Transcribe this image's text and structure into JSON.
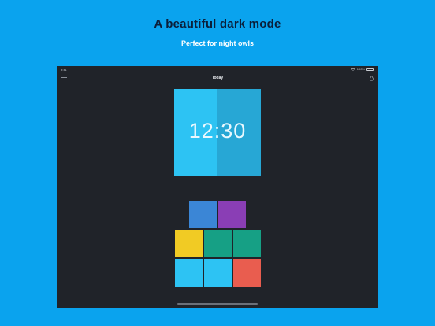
{
  "header": {
    "title": "A beautiful dark mode",
    "subtitle": "Perfect for night owls"
  },
  "status_bar": {
    "time": "9:41",
    "battery_label": "100%",
    "icons": [
      "wifi-icon",
      "battery-icon"
    ]
  },
  "nav": {
    "title": "Today",
    "left_icon": "menu-icon",
    "right_icon": "drop-icon"
  },
  "clock": {
    "time": "12:30",
    "color_left": "#2dc3f3",
    "color_right": "#27a7d5"
  },
  "palette": {
    "rows": [
      [
        "#3b86d6",
        "#8a3eb5"
      ],
      [
        "#f1cb24",
        "#16a085",
        "#16a085"
      ],
      [
        "#2dc3f3",
        "#2dc3f3",
        "#e95d4f"
      ]
    ]
  },
  "colors": {
    "background": "#0aa3ee",
    "device": "#202329",
    "title_text": "#0b1f3a"
  }
}
